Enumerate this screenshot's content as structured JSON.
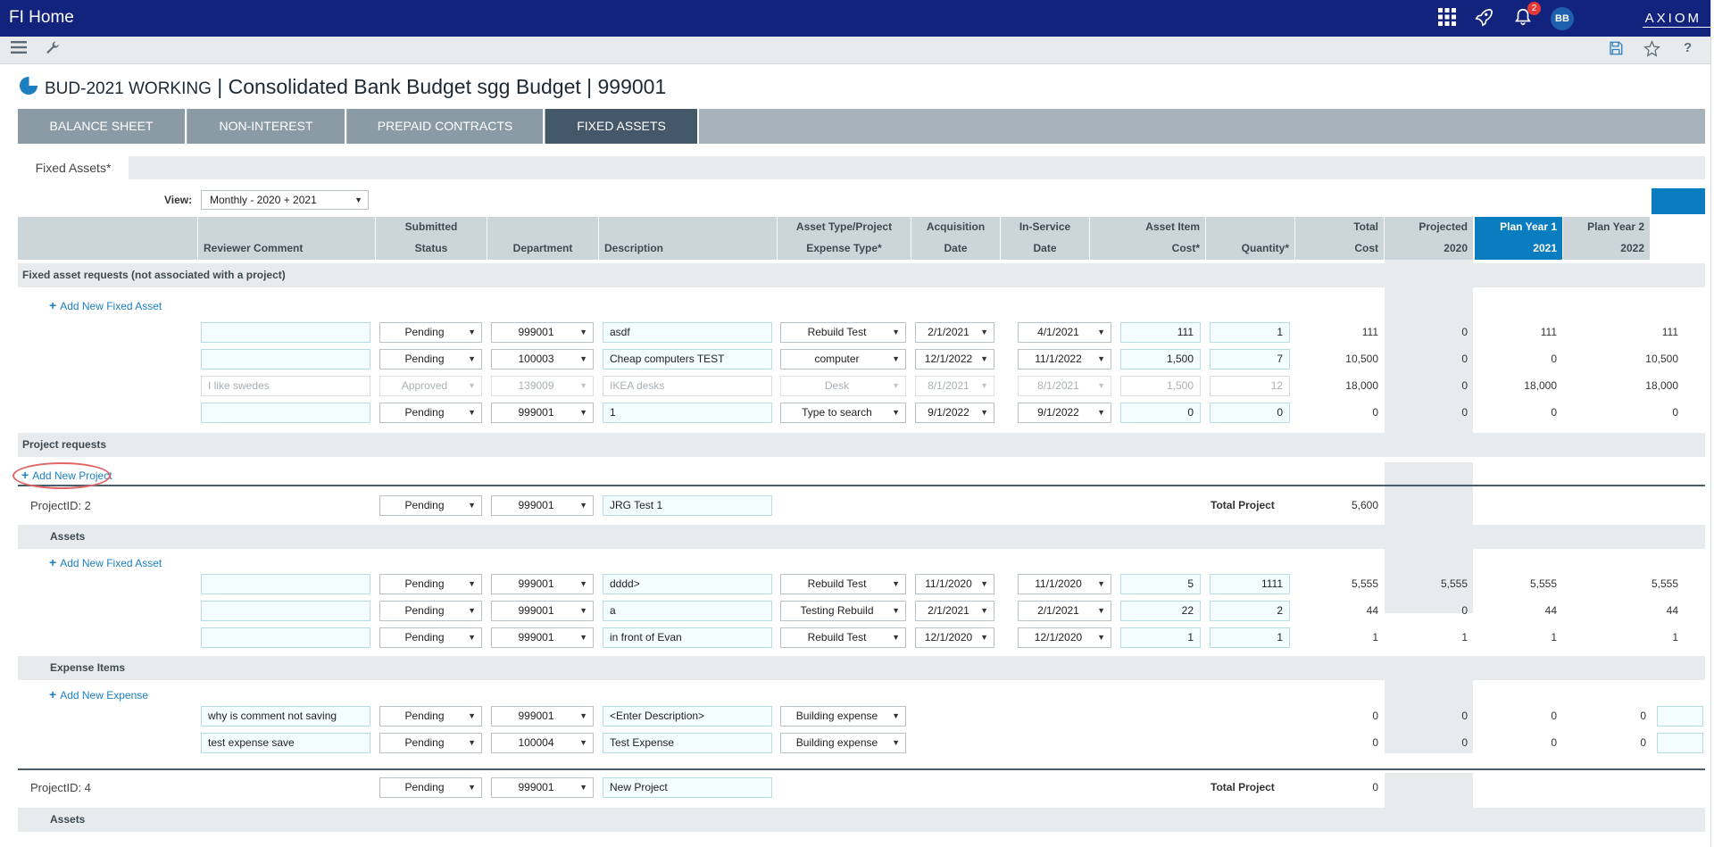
{
  "app": {
    "title": "FI Home",
    "notification_count": "2",
    "user_initials": "BB",
    "brand": "AXIOM"
  },
  "page": {
    "prefix": "BUD-2021 WORKING",
    "title": " | Consolidated Bank Budget sgg Budget | 999001"
  },
  "tabs": [
    {
      "label": "BALANCE SHEET"
    },
    {
      "label": "NON-INTEREST"
    },
    {
      "label": "PREPAID CONTRACTS"
    },
    {
      "label": "FIXED ASSETS",
      "active": true
    }
  ],
  "sheet_tab": "Fixed Assets*",
  "view": {
    "label": "View:",
    "value": "Monthly - 2020 + 2021"
  },
  "columns": [
    {
      "l1": "",
      "l2": "Reviewer Comment"
    },
    {
      "l1": "Submitted",
      "l2": "Status"
    },
    {
      "l1": "",
      "l2": "Department"
    },
    {
      "l1": "",
      "l2": "Description"
    },
    {
      "l1": "Asset Type/Project",
      "l2": "Expense Type*"
    },
    {
      "l1": "Acquisition",
      "l2": "Date"
    },
    {
      "l1": "In-Service",
      "l2": "Date"
    },
    {
      "l1": "Asset Item",
      "l2": "Cost*"
    },
    {
      "l1": "",
      "l2": "Quantity*"
    },
    {
      "l1": "Total",
      "l2": "Cost"
    },
    {
      "l1": "Projected",
      "l2": "2020"
    },
    {
      "l1": "Plan Year 1",
      "l2": "2021"
    },
    {
      "l1": "Plan Year 2",
      "l2": "2022"
    }
  ],
  "sections": {
    "fixed_requests": "Fixed asset requests (not associated with a project)",
    "project_requests": "Project requests",
    "assets": "Assets",
    "expense_items": "Expense Items"
  },
  "links": {
    "add_fixed_asset": "Add New Fixed Asset",
    "add_project": "Add New Project",
    "add_expense": "Add New Expense"
  },
  "fixed_assets": [
    {
      "comment": "",
      "status": "Pending",
      "dept": "999001",
      "desc": "asdf",
      "type": "Rebuild Test",
      "acq": "2/1/2021",
      "svc": "4/1/2021",
      "cost": "111",
      "qty": "1",
      "total": "111",
      "p2020": "0",
      "p2021": "111",
      "p2022": "111"
    },
    {
      "comment": "",
      "status": "Pending",
      "dept": "100003",
      "desc": "Cheap computers TEST",
      "type": "computer",
      "acq": "12/1/2022",
      "svc": "11/1/2022",
      "cost": "1,500",
      "qty": "7",
      "total": "10,500",
      "p2020": "0",
      "p2021": "0",
      "p2022": "10,500"
    },
    {
      "comment": "I like swedes",
      "status": "Approved",
      "dept": "139009",
      "desc": "IKEA desks",
      "type": "Desk",
      "acq": "8/1/2021",
      "svc": "8/1/2021",
      "cost": "1,500",
      "qty": "12",
      "total": "18,000",
      "p2020": "0",
      "p2021": "18,000",
      "p2022": "18,000",
      "disabled": true
    },
    {
      "comment": "",
      "status": "Pending",
      "dept": "999001",
      "desc": "1",
      "type": "Type to search",
      "acq": "9/1/2022",
      "svc": "9/1/2022",
      "cost": "0",
      "qty": "0",
      "total": "0",
      "p2020": "0",
      "p2021": "0",
      "p2022": "0"
    }
  ],
  "project2": {
    "label": "ProjectID: 2",
    "status": "Pending",
    "dept": "999001",
    "desc": "JRG Test 1",
    "total_label": "Total Project",
    "total": "5,600",
    "assets": [
      {
        "comment": "",
        "status": "Pending",
        "dept": "999001",
        "desc": "dddd>",
        "type": "Rebuild Test",
        "acq": "11/1/2020",
        "svc": "11/1/2020",
        "cost": "5",
        "qty": "1111",
        "total": "5,555",
        "p2020": "5,555",
        "p2021": "5,555",
        "p2022": "5,555"
      },
      {
        "comment": "",
        "status": "Pending",
        "dept": "999001",
        "desc": "a",
        "type": "Testing Rebuild",
        "acq": "2/1/2021",
        "svc": "2/1/2021",
        "cost": "22",
        "qty": "2",
        "total": "44",
        "p2020": "0",
        "p2021": "44",
        "p2022": "44"
      },
      {
        "comment": "",
        "status": "Pending",
        "dept": "999001",
        "desc": "in front of Evan",
        "type": "Rebuild Test",
        "acq": "12/1/2020",
        "svc": "12/1/2020",
        "cost": "1",
        "qty": "1",
        "total": "1",
        "p2020": "1",
        "p2021": "1",
        "p2022": "1"
      }
    ],
    "expenses": [
      {
        "comment": "why is comment not saving",
        "status": "Pending",
        "dept": "999001",
        "desc": "<Enter Description>",
        "type": "Building expense",
        "total": "0",
        "p2020": "0",
        "p2021": "0",
        "p2022": "0"
      },
      {
        "comment": "test expense save",
        "status": "Pending",
        "dept": "100004",
        "desc": "Test Expense",
        "type": "Building expense",
        "total": "0",
        "p2020": "0",
        "p2021": "0",
        "p2022": "0"
      }
    ]
  },
  "project4": {
    "label": "ProjectID: 4",
    "status": "Pending",
    "dept": "999001",
    "desc": "New Project",
    "total_label": "Total Project",
    "total": "0"
  },
  "colors": {
    "topbar": "#12237e",
    "accent": "#0a7dc0",
    "link": "#1b80c2",
    "callout": "#e06666"
  }
}
